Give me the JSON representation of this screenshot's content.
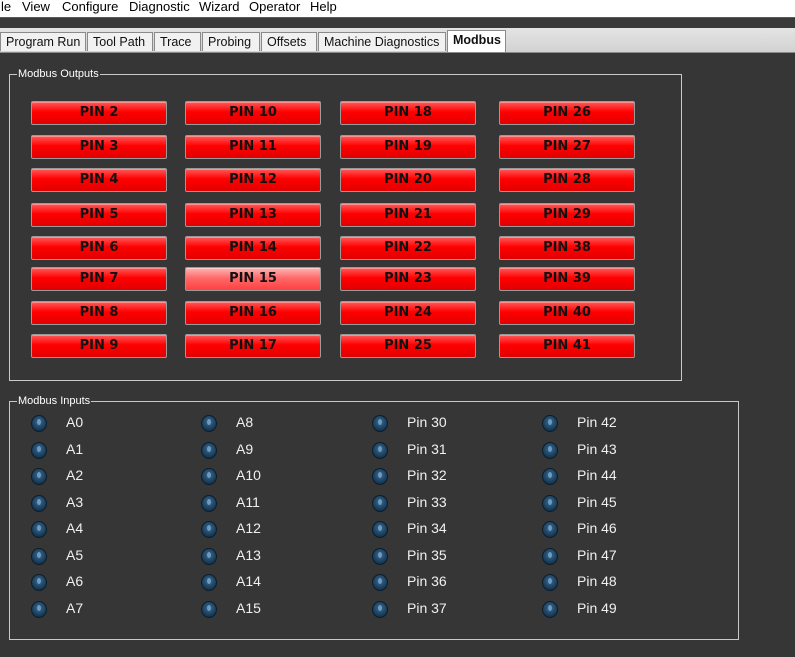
{
  "menu": [
    "le",
    "View",
    "Configure",
    "Diagnostic",
    "Wizard",
    "Operator",
    "Help"
  ],
  "tabs": [
    "Program Run",
    "Tool Path",
    "Trace",
    "Probing",
    "Offsets",
    "Machine Diagnostics",
    "Modbus"
  ],
  "active_tab": "Modbus",
  "outputs": {
    "title": "Modbus Outputs",
    "hovered": "PIN 15",
    "columns": [
      [
        "PIN 2",
        "PIN 3",
        "PIN 4",
        "PIN 5",
        "PIN 6",
        "PIN 7",
        "PIN 8",
        "PIN 9"
      ],
      [
        "PIN 10",
        "PIN 11",
        "PIN 12",
        "PIN 13",
        "PIN 14",
        "PIN 15",
        "PIN 16",
        "PIN 17"
      ],
      [
        "PIN 18",
        "PIN 19",
        "PIN 20",
        "PIN 21",
        "PIN 22",
        "PIN 23",
        "PIN 24",
        "PIN 25"
      ],
      [
        "PIN 26",
        "PIN 27",
        "PIN 28",
        "PIN 29",
        "PIN 38",
        "PIN 39",
        "PIN 40",
        "PIN 41"
      ]
    ]
  },
  "inputs": {
    "title": "Modbus Inputs",
    "columns": [
      [
        "A0",
        "A1",
        "A2",
        "A3",
        "A4",
        "A5",
        "A6",
        "A7"
      ],
      [
        "A8",
        "A9",
        "A10",
        "A11",
        "A12",
        "A13",
        "A14",
        "A15"
      ],
      [
        "Pin 30",
        "Pin 31",
        "Pin 32",
        "Pin 33",
        "Pin 34",
        "Pin 35",
        "Pin 36",
        "Pin 37"
      ],
      [
        "Pin 42",
        "Pin 43",
        "Pin 44",
        "Pin 45",
        "Pin 46",
        "Pin 47",
        "Pin 48",
        "Pin 49"
      ]
    ]
  },
  "colors": {
    "background": "#363636",
    "output_on": "#ff0000",
    "led_off": "#1d4262",
    "groupbox_border": "#c9c9c9"
  }
}
